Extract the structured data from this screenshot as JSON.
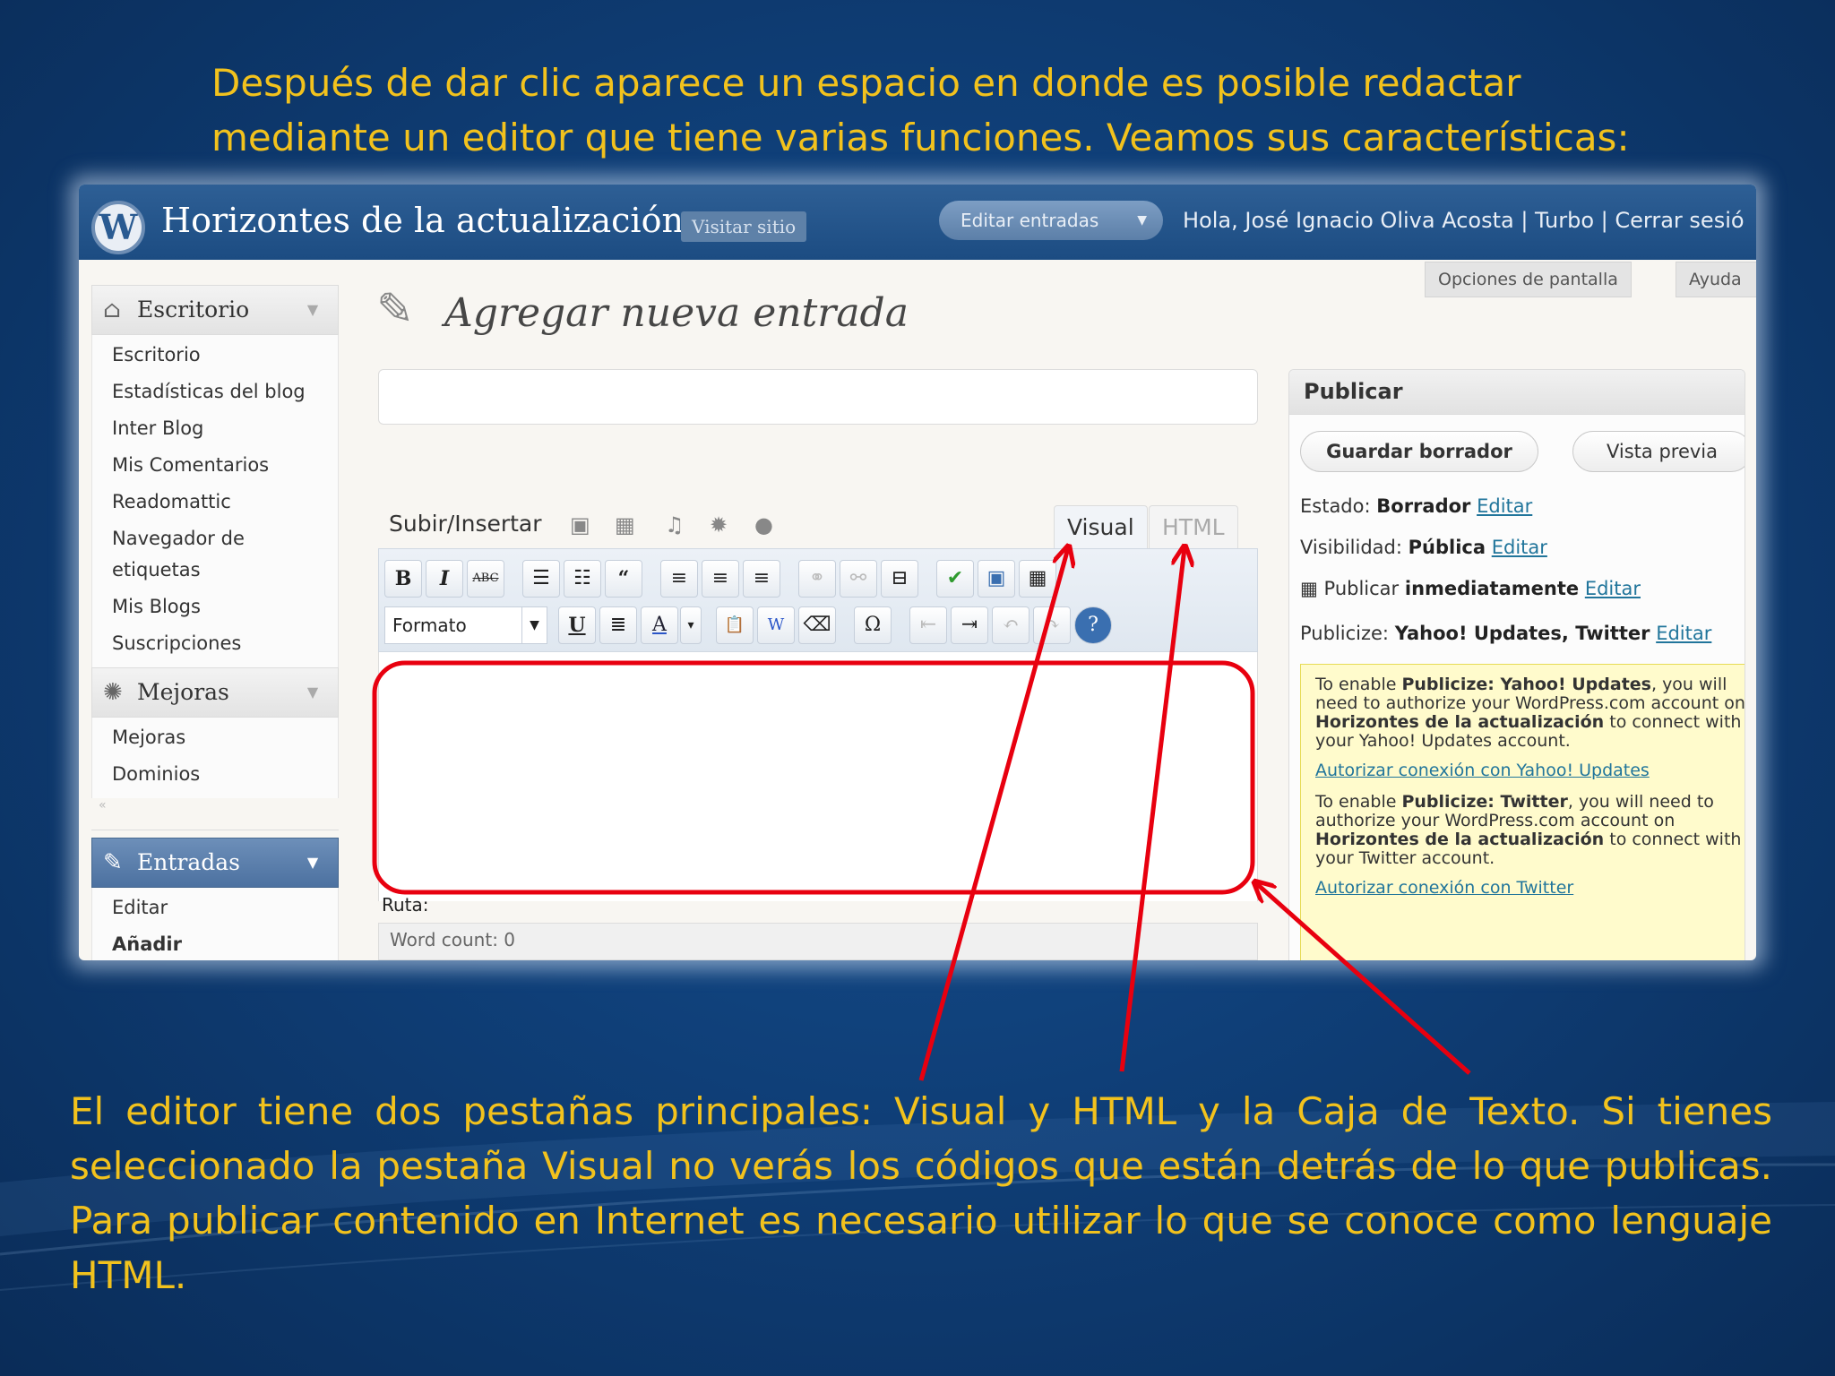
{
  "intro": {
    "line1": "Después de dar clic aparece un espacio en donde es posible redactar",
    "line2": "mediante un editor que tiene varias funciones. Veamos  sus características:"
  },
  "caption": {
    "text": "El editor tiene dos pestañas principales: Visual y HTML y la Caja de Texto. Si tienes seleccionado la pestaña  Visual no verás los códigos que están detrás de lo que publicas. Para publicar contenido en Internet es necesario utilizar lo que se conoce como  lenguaje HTML."
  },
  "colors": {
    "slide_text": "#f2c21d",
    "annotation": "#e8000f",
    "admin_bar": "#1c4c82",
    "link": "#21759b"
  },
  "admin_bar": {
    "logo": "W",
    "site_title": "Horizontes de la actualización",
    "visit_site": "Visitar sitio",
    "edit_posts": "Editar entradas",
    "greeting": "Hola, José Ignacio Oliva Acosta | Turbo | Cerrar sesió"
  },
  "screen_options": "Opciones de pantalla",
  "help": "Ayuda",
  "sidebar": {
    "dashboard_head": "Escritorio",
    "dashboard_items": [
      "Escritorio",
      "Estadísticas del blog",
      "Inter Blog",
      "Mis Comentarios",
      "Readomattic",
      "Navegador de\netiquetas",
      "Mis Blogs",
      "Suscripciones"
    ],
    "upgrades_head": "Mejoras",
    "upgrades_items": [
      "Mejoras",
      "Dominios"
    ],
    "posts_head": "Entradas",
    "posts_items": [
      "Editar",
      "Añadir"
    ]
  },
  "editor": {
    "page_heading": "Agregar nueva entrada",
    "upload_label": "Subir/Insertar",
    "tab_visual": "Visual",
    "tab_html": "HTML",
    "format_select": "Formato",
    "path_label": "Ruta:",
    "word_count": "Word count: 0",
    "toolbar_row1": [
      "B",
      "I",
      "ABC",
      "☰",
      "☷",
      "“",
      "≡",
      "≡",
      "≡",
      "⚭",
      "⚯",
      "⊟",
      "✔",
      "▣",
      "▦"
    ],
    "toolbar_row2": [
      "U",
      "≣",
      "A",
      "▾",
      "📋",
      "W",
      "⌫",
      "Ω",
      "⇤",
      "⇥",
      "↶",
      "↷",
      "?"
    ]
  },
  "publish": {
    "heading": "Publicar",
    "save_draft": "Guardar borrador",
    "preview": "Vista previa",
    "status_label": "Estado:",
    "status_value": "Borrador",
    "visibility_label": "Visibilidad:",
    "visibility_value": "Pública",
    "publish_label": "Publicar",
    "publish_value": "inmediatamente",
    "publicize_label": "Publicize:",
    "publicize_value": "Yahoo! Updates, Twitter",
    "edit": "Editar",
    "note_yahoo_1": "To enable ",
    "note_yahoo_bold": "Publicize: Yahoo! Updates",
    "note_yahoo_2": ", you will need to authorize your WordPress.com account on",
    "note_site": "Horizontes de la actualización",
    "note_yahoo_3": " to connect with your Yahoo! Updates account.",
    "auth_yahoo": "Autorizar conexión con Yahoo! Updates",
    "note_tw_1": "To enable ",
    "note_tw_bold": "Publicize: Twitter",
    "note_tw_2": ", you will need to authorize your WordPress.com account on",
    "note_tw_3": " to connect with your Twitter account.",
    "auth_twitter": "Autorizar conexión con Twitter"
  }
}
